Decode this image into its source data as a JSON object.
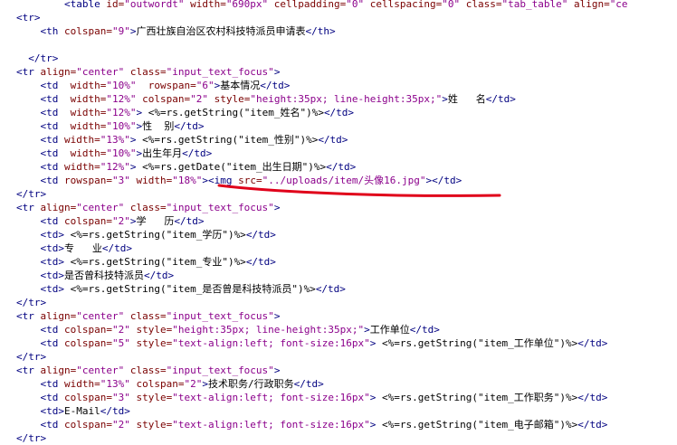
{
  "editor": {
    "lines": [
      [
        {
          "t": "        ",
          "c": "text"
        },
        {
          "t": "<table ",
          "c": "tag"
        },
        {
          "t": "id=",
          "c": "attr"
        },
        {
          "t": "\"outwordt\"",
          "c": "str"
        },
        {
          "t": " width=",
          "c": "attr"
        },
        {
          "t": "\"690px\"",
          "c": "str"
        },
        {
          "t": " cellpadding=",
          "c": "attr"
        },
        {
          "t": "\"0\"",
          "c": "str"
        },
        {
          "t": " cellspacing=",
          "c": "attr"
        },
        {
          "t": "\"0\"",
          "c": "str"
        },
        {
          "t": " class=",
          "c": "attr"
        },
        {
          "t": "\"tab_table\"",
          "c": "str"
        },
        {
          "t": " align=",
          "c": "attr"
        },
        {
          "t": "\"ce",
          "c": "str"
        }
      ],
      [
        {
          "t": "<tr>",
          "c": "tag"
        }
      ],
      [
        {
          "t": "    ",
          "c": "text"
        },
        {
          "t": "<th ",
          "c": "tag"
        },
        {
          "t": "colspan=",
          "c": "attr"
        },
        {
          "t": "\"9\"",
          "c": "str"
        },
        {
          "t": ">",
          "c": "tag"
        },
        {
          "t": "广西壮族自治区农村科技特派员申请表",
          "c": "text"
        },
        {
          "t": "</th>",
          "c": "tag"
        }
      ],
      [],
      [
        {
          "t": "  ",
          "c": "text"
        },
        {
          "t": "</tr>",
          "c": "tag"
        }
      ],
      [
        {
          "t": "<tr ",
          "c": "tag"
        },
        {
          "t": "align=",
          "c": "attr"
        },
        {
          "t": "\"center\"",
          "c": "str"
        },
        {
          "t": " class=",
          "c": "attr"
        },
        {
          "t": "\"input_text_focus\"",
          "c": "str"
        },
        {
          "t": ">",
          "c": "tag"
        }
      ],
      [
        {
          "t": "    ",
          "c": "text"
        },
        {
          "t": "<td  ",
          "c": "tag"
        },
        {
          "t": "width=",
          "c": "attr"
        },
        {
          "t": "\"10%\"",
          "c": "str"
        },
        {
          "t": "  rowspan=",
          "c": "attr"
        },
        {
          "t": "\"6\"",
          "c": "str"
        },
        {
          "t": ">",
          "c": "tag"
        },
        {
          "t": "基本情况",
          "c": "text"
        },
        {
          "t": "</td>",
          "c": "tag"
        }
      ],
      [
        {
          "t": "    ",
          "c": "text"
        },
        {
          "t": "<td  ",
          "c": "tag"
        },
        {
          "t": "width=",
          "c": "attr"
        },
        {
          "t": "\"12%\"",
          "c": "str"
        },
        {
          "t": " colspan=",
          "c": "attr"
        },
        {
          "t": "\"2\"",
          "c": "str"
        },
        {
          "t": " style=",
          "c": "attr"
        },
        {
          "t": "\"height:35px; line-height:35px;\"",
          "c": "str"
        },
        {
          "t": ">",
          "c": "tag"
        },
        {
          "t": "姓   名",
          "c": "text"
        },
        {
          "t": "</td>",
          "c": "tag"
        }
      ],
      [
        {
          "t": "    ",
          "c": "text"
        },
        {
          "t": "<td  ",
          "c": "tag"
        },
        {
          "t": "width=",
          "c": "attr"
        },
        {
          "t": "\"12%\"",
          "c": "str"
        },
        {
          "t": "> ",
          "c": "tag"
        },
        {
          "t": "<%=rs.getString(\"item_姓名\")%>",
          "c": "text"
        },
        {
          "t": "</td>",
          "c": "tag"
        }
      ],
      [
        {
          "t": "    ",
          "c": "text"
        },
        {
          "t": "<td  ",
          "c": "tag"
        },
        {
          "t": "width=",
          "c": "attr"
        },
        {
          "t": "\"10%\"",
          "c": "str"
        },
        {
          "t": ">",
          "c": "tag"
        },
        {
          "t": "性  别",
          "c": "text"
        },
        {
          "t": "</td>",
          "c": "tag"
        }
      ],
      [
        {
          "t": "    ",
          "c": "text"
        },
        {
          "t": "<td ",
          "c": "tag"
        },
        {
          "t": "width=",
          "c": "attr"
        },
        {
          "t": "\"13%\"",
          "c": "str"
        },
        {
          "t": "> ",
          "c": "tag"
        },
        {
          "t": "<%=rs.getString(\"item_性别\")%>",
          "c": "text"
        },
        {
          "t": "</td>",
          "c": "tag"
        }
      ],
      [
        {
          "t": "    ",
          "c": "text"
        },
        {
          "t": "<td  ",
          "c": "tag"
        },
        {
          "t": "width=",
          "c": "attr"
        },
        {
          "t": "\"10%\"",
          "c": "str"
        },
        {
          "t": ">",
          "c": "tag"
        },
        {
          "t": "出生年月",
          "c": "text"
        },
        {
          "t": "</td>",
          "c": "tag"
        }
      ],
      [
        {
          "t": "    ",
          "c": "text"
        },
        {
          "t": "<td ",
          "c": "tag"
        },
        {
          "t": "width=",
          "c": "attr"
        },
        {
          "t": "\"12%\"",
          "c": "str"
        },
        {
          "t": "> ",
          "c": "tag"
        },
        {
          "t": "<%=rs.getDate(\"item_出生日期\")%>",
          "c": "text"
        },
        {
          "t": "</td>",
          "c": "tag"
        }
      ],
      [
        {
          "t": "    ",
          "c": "text"
        },
        {
          "t": "<td ",
          "c": "tag"
        },
        {
          "t": "rowspan=",
          "c": "attr"
        },
        {
          "t": "\"3\"",
          "c": "str"
        },
        {
          "t": " width=",
          "c": "attr"
        },
        {
          "t": "\"18%\"",
          "c": "str"
        },
        {
          "t": ">",
          "c": "tag"
        },
        {
          "t": "<img ",
          "c": "tag"
        },
        {
          "t": "src=",
          "c": "attr"
        },
        {
          "t": "\"../uploads/item/头像16.jpg\"",
          "c": "str"
        },
        {
          "t": ">",
          "c": "tag"
        },
        {
          "t": "</td>",
          "c": "tag"
        }
      ],
      [
        {
          "t": "</tr>",
          "c": "tag"
        }
      ],
      [
        {
          "t": "<tr ",
          "c": "tag"
        },
        {
          "t": "align=",
          "c": "attr"
        },
        {
          "t": "\"center\"",
          "c": "str"
        },
        {
          "t": " class=",
          "c": "attr"
        },
        {
          "t": "\"input_text_focus\"",
          "c": "str"
        },
        {
          "t": ">",
          "c": "tag"
        }
      ],
      [
        {
          "t": "    ",
          "c": "text"
        },
        {
          "t": "<td ",
          "c": "tag"
        },
        {
          "t": "colspan=",
          "c": "attr"
        },
        {
          "t": "\"2\"",
          "c": "str"
        },
        {
          "t": ">",
          "c": "tag"
        },
        {
          "t": "学   历",
          "c": "text"
        },
        {
          "t": "</td>",
          "c": "tag"
        }
      ],
      [
        {
          "t": "    ",
          "c": "text"
        },
        {
          "t": "<td>",
          "c": "tag"
        },
        {
          "t": " <%=rs.getString(\"item_学历\")%>",
          "c": "text"
        },
        {
          "t": "</td>",
          "c": "tag"
        }
      ],
      [
        {
          "t": "    ",
          "c": "text"
        },
        {
          "t": "<td>",
          "c": "tag"
        },
        {
          "t": "专   业",
          "c": "text"
        },
        {
          "t": "</td>",
          "c": "tag"
        }
      ],
      [
        {
          "t": "    ",
          "c": "text"
        },
        {
          "t": "<td>",
          "c": "tag"
        },
        {
          "t": " <%=rs.getString(\"item_专业\")%>",
          "c": "text"
        },
        {
          "t": "</td>",
          "c": "tag"
        }
      ],
      [
        {
          "t": "    ",
          "c": "text"
        },
        {
          "t": "<td>",
          "c": "tag"
        },
        {
          "t": "是否曾科技特派员",
          "c": "text"
        },
        {
          "t": "</td>",
          "c": "tag"
        }
      ],
      [
        {
          "t": "    ",
          "c": "text"
        },
        {
          "t": "<td>",
          "c": "tag"
        },
        {
          "t": " <%=rs.getString(\"item_是否曾是科技特派员\")%>",
          "c": "text"
        },
        {
          "t": "</td>",
          "c": "tag"
        }
      ],
      [
        {
          "t": "</tr>",
          "c": "tag"
        }
      ],
      [
        {
          "t": "<tr ",
          "c": "tag"
        },
        {
          "t": "align=",
          "c": "attr"
        },
        {
          "t": "\"center\"",
          "c": "str"
        },
        {
          "t": " class=",
          "c": "attr"
        },
        {
          "t": "\"input_text_focus\"",
          "c": "str"
        },
        {
          "t": ">",
          "c": "tag"
        }
      ],
      [
        {
          "t": "    ",
          "c": "text"
        },
        {
          "t": "<td ",
          "c": "tag"
        },
        {
          "t": "colspan=",
          "c": "attr"
        },
        {
          "t": "\"2\"",
          "c": "str"
        },
        {
          "t": " style=",
          "c": "attr"
        },
        {
          "t": "\"height:35px; line-height:35px;\"",
          "c": "str"
        },
        {
          "t": ">",
          "c": "tag"
        },
        {
          "t": "工作单位",
          "c": "text"
        },
        {
          "t": "</td>",
          "c": "tag"
        }
      ],
      [
        {
          "t": "    ",
          "c": "text"
        },
        {
          "t": "<td ",
          "c": "tag"
        },
        {
          "t": "colspan=",
          "c": "attr"
        },
        {
          "t": "\"5\"",
          "c": "str"
        },
        {
          "t": " style=",
          "c": "attr"
        },
        {
          "t": "\"text-align:left; font-size:16px\"",
          "c": "str"
        },
        {
          "t": "> ",
          "c": "tag"
        },
        {
          "t": "<%=rs.getString(\"item_工作单位\")%>",
          "c": "text"
        },
        {
          "t": "</td>",
          "c": "tag"
        }
      ],
      [
        {
          "t": "</tr>",
          "c": "tag"
        }
      ],
      [
        {
          "t": "<tr ",
          "c": "tag"
        },
        {
          "t": "align=",
          "c": "attr"
        },
        {
          "t": "\"center\"",
          "c": "str"
        },
        {
          "t": " class=",
          "c": "attr"
        },
        {
          "t": "\"input_text_focus\"",
          "c": "str"
        },
        {
          "t": ">",
          "c": "tag"
        }
      ],
      [
        {
          "t": "    ",
          "c": "text"
        },
        {
          "t": "<td ",
          "c": "tag"
        },
        {
          "t": "width=",
          "c": "attr"
        },
        {
          "t": "\"13%\"",
          "c": "str"
        },
        {
          "t": " colspan=",
          "c": "attr"
        },
        {
          "t": "\"2\"",
          "c": "str"
        },
        {
          "t": ">",
          "c": "tag"
        },
        {
          "t": "技术职务/行政职务",
          "c": "text"
        },
        {
          "t": "</td>",
          "c": "tag"
        }
      ],
      [
        {
          "t": "    ",
          "c": "text"
        },
        {
          "t": "<td ",
          "c": "tag"
        },
        {
          "t": "colspan=",
          "c": "attr"
        },
        {
          "t": "\"3\"",
          "c": "str"
        },
        {
          "t": " style=",
          "c": "attr"
        },
        {
          "t": "\"text-align:left; font-size:16px\"",
          "c": "str"
        },
        {
          "t": "> ",
          "c": "tag"
        },
        {
          "t": "<%=rs.getString(\"item_工作职务\")%>",
          "c": "text"
        },
        {
          "t": "</td>",
          "c": "tag"
        }
      ],
      [
        {
          "t": "    ",
          "c": "text"
        },
        {
          "t": "<td>",
          "c": "tag"
        },
        {
          "t": "E-Mail",
          "c": "text"
        },
        {
          "t": "</td>",
          "c": "tag"
        }
      ],
      [
        {
          "t": "    ",
          "c": "text"
        },
        {
          "t": "<td ",
          "c": "tag"
        },
        {
          "t": "colspan=",
          "c": "attr"
        },
        {
          "t": "\"2\"",
          "c": "str"
        },
        {
          "t": " style=",
          "c": "attr"
        },
        {
          "t": "\"text-align:left; font-size:16px\"",
          "c": "str"
        },
        {
          "t": "> ",
          "c": "tag"
        },
        {
          "t": "<%=rs.getString(\"item_电子邮箱\")%>",
          "c": "text"
        },
        {
          "t": "</td>",
          "c": "tag"
        }
      ],
      [
        {
          "t": "</tr>",
          "c": "tag"
        }
      ]
    ],
    "colors": {
      "tag": "#000080",
      "attribute": "#7a0000",
      "string": "#8b008b",
      "annotation": "#e0001a"
    }
  }
}
